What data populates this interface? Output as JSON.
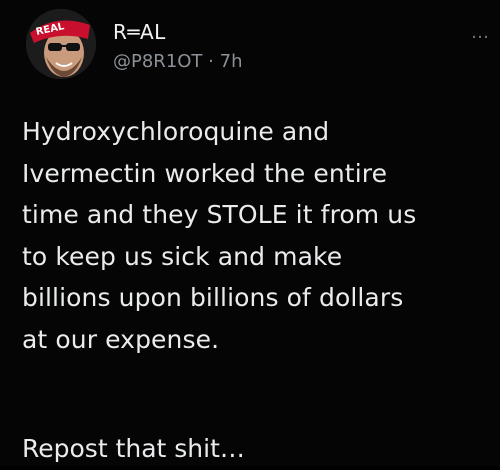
{
  "post": {
    "author": {
      "display_name": "R═AL",
      "handle": "@P8R1OT",
      "separator": "·",
      "time": "7h",
      "avatar_icon": "profile-avatar",
      "cap_text": "REAL"
    },
    "more_icon": "more-options-icon",
    "more_glyph": "…",
    "body_lines": [
      "Hydroxychloroquine and",
      "Ivermectin worked the entire",
      "time and they STOLE it from us",
      "to keep us sick and make",
      "billions upon billions of dollars",
      "at our expense."
    ],
    "footer_line": "Repost that shit…"
  },
  "colors": {
    "background": "#050505",
    "text": "#e9ebec",
    "secondary_text": "#8b9196",
    "cap_red": "#c8102e"
  }
}
